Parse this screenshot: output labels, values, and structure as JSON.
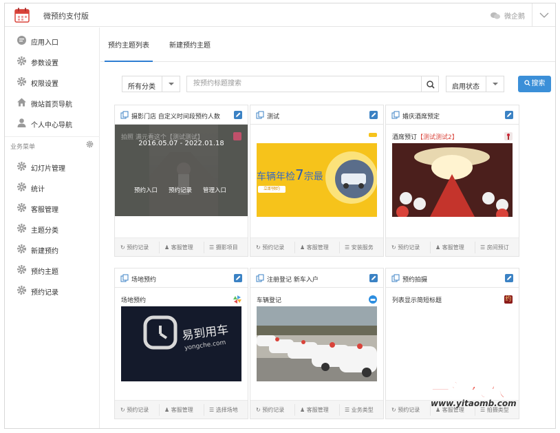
{
  "app": {
    "title": "微预约支付版",
    "account": "微企鹅"
  },
  "sidebar": {
    "top_items": [
      {
        "label": "应用入口",
        "icon": "chat-bubble-icon"
      },
      {
        "label": "参数设置",
        "icon": "gear-icon"
      },
      {
        "label": "权限设置",
        "icon": "gear-icon"
      },
      {
        "label": "微站首页导航",
        "icon": "home-icon"
      },
      {
        "label": "个人中心导航",
        "icon": "user-icon"
      }
    ],
    "section_label": "业务菜单",
    "biz_items": [
      {
        "label": "幻灯片管理"
      },
      {
        "label": "统计"
      },
      {
        "label": "客服管理"
      },
      {
        "label": "主题分类"
      },
      {
        "label": "新建预约"
      },
      {
        "label": "预约主题"
      },
      {
        "label": "预约记录"
      }
    ]
  },
  "tabs": [
    {
      "label": "预约主题列表",
      "active": true
    },
    {
      "label": "新建预约主题",
      "active": false
    }
  ],
  "filters": {
    "category": "所有分类",
    "search_placeholder": "按预约标题搜索",
    "status": "启用状态",
    "search_button": "搜索"
  },
  "cards": [
    {
      "title": "摄影门店 自定义时间段预约人数",
      "subtitle": "拍照 满元看这个【测试测试】",
      "overlay": {
        "date": "2016.05.07 - 2022.01.18",
        "links": [
          "预约入口",
          "预约记录",
          "管理入口"
        ]
      },
      "footer": [
        "预约记录",
        "客服管理",
        "摄影项目"
      ]
    },
    {
      "title": "测试",
      "subtitle": "",
      "banner_text": "车辆年检",
      "banner_highlight": "7",
      "banner_tail": "宗最",
      "banner_button": "立即预约",
      "footer": [
        "预约记录",
        "客服管理",
        "安装服务"
      ]
    },
    {
      "title": "婚庆酒席预定",
      "subtitle_prefix": "酒席预订",
      "subtitle_red": "【测试测试2】",
      "footer": [
        "预约记录",
        "客服管理",
        "房间预订"
      ]
    },
    {
      "title": "场地预约",
      "subtitle": "场地预约",
      "image_text": "易到用车",
      "image_sub": "yongche.com",
      "footer": [
        "预约记录",
        "客服管理",
        "选择场地"
      ]
    },
    {
      "title": "注册登记 新车入户",
      "subtitle": "车辆登记",
      "footer": [
        "预约记录",
        "客服管理",
        "业务类型"
      ]
    },
    {
      "title": "预约拍摄",
      "subtitle": "列表显示简短标题",
      "badge_text": "约",
      "footer": [
        "预约记录",
        "客服管理",
        "拍摄类型"
      ]
    }
  ],
  "watermark": {
    "text": "一淘模板",
    "url": "www.yitaomb.com"
  },
  "colors": {
    "accent": "#2d7dd2",
    "button": "#3b8fd8",
    "red": "#d9433a"
  }
}
